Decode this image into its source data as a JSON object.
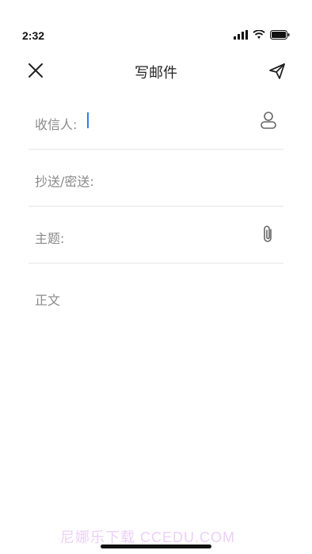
{
  "status_bar": {
    "time": "2:32"
  },
  "nav": {
    "title": "写邮件"
  },
  "fields": {
    "to_label": "收信人:",
    "to_value": "",
    "cc_label": "抄送/密送:",
    "cc_value": "",
    "subject_label": "主题:",
    "subject_value": ""
  },
  "body": {
    "label": "正文"
  },
  "watermark": "尼娜乐下载 CCEDU.COM",
  "colors": {
    "accent": "#2f7bf5",
    "label": "#8a8a8a",
    "divider": "#e6e6e6"
  }
}
